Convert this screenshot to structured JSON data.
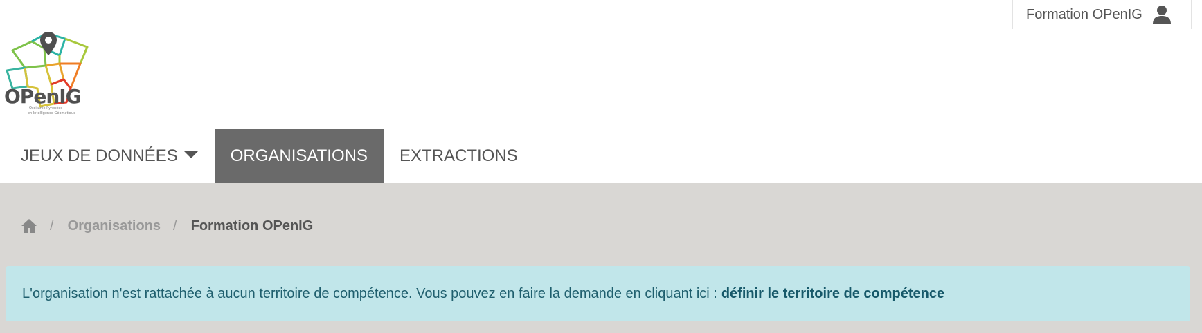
{
  "user": {
    "name": "Formation OPenIG",
    "icon": "user-icon"
  },
  "logo": {
    "name": "OPenIG",
    "tagline_line1": "Occitanie Pyrénées",
    "tagline_line2": "en Intelligence Géomatique"
  },
  "nav": {
    "items": [
      {
        "label": "JEUX DE DONNÉES",
        "has_dropdown": true,
        "active": false
      },
      {
        "label": "ORGANISATIONS",
        "active": true
      },
      {
        "label": "EXTRACTIONS",
        "active": false
      }
    ]
  },
  "breadcrumb": {
    "home_icon": "home-icon",
    "separator": "/",
    "items": [
      {
        "label": "Organisations"
      },
      {
        "label": "Formation OPenIG"
      }
    ]
  },
  "alert": {
    "message": "L'organisation n'est rattachée à aucun territoire de compétence. Vous pouvez en faire la demande en cliquant ici :",
    "link_label": "définir le territoire de compétence"
  },
  "colors": {
    "nav_active_bg": "#6a6a6a",
    "content_bg": "#d9d7d4",
    "alert_bg": "#c1e6ea",
    "alert_text": "#1f5f6e"
  }
}
